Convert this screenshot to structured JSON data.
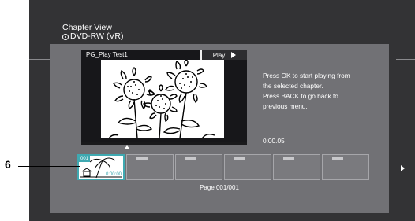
{
  "header": {
    "title": "Chapter View",
    "subtitle": "DVD-RW (VR)",
    "disc_icon": "disc-icon"
  },
  "preview": {
    "chapter_name": "PG_Play Test1",
    "mode_label": "Play",
    "mode_icon": "play-icon",
    "image_subject": "sunflowers line drawing"
  },
  "message": {
    "line1": "Press OK to start playing from",
    "line2": "the selected chapter.",
    "line3": "Press BACK to go back to",
    "line4": "previous menu."
  },
  "time": "0:00.05",
  "thumbnails": {
    "selected_number": "001",
    "selected_time": "0:00:00",
    "count": 6
  },
  "page_label": "Page 001/001",
  "callout": "6",
  "colors": {
    "screen": "#333335",
    "panel": "#717175",
    "accent": "#3fa9b1",
    "text": "#ffffff"
  }
}
